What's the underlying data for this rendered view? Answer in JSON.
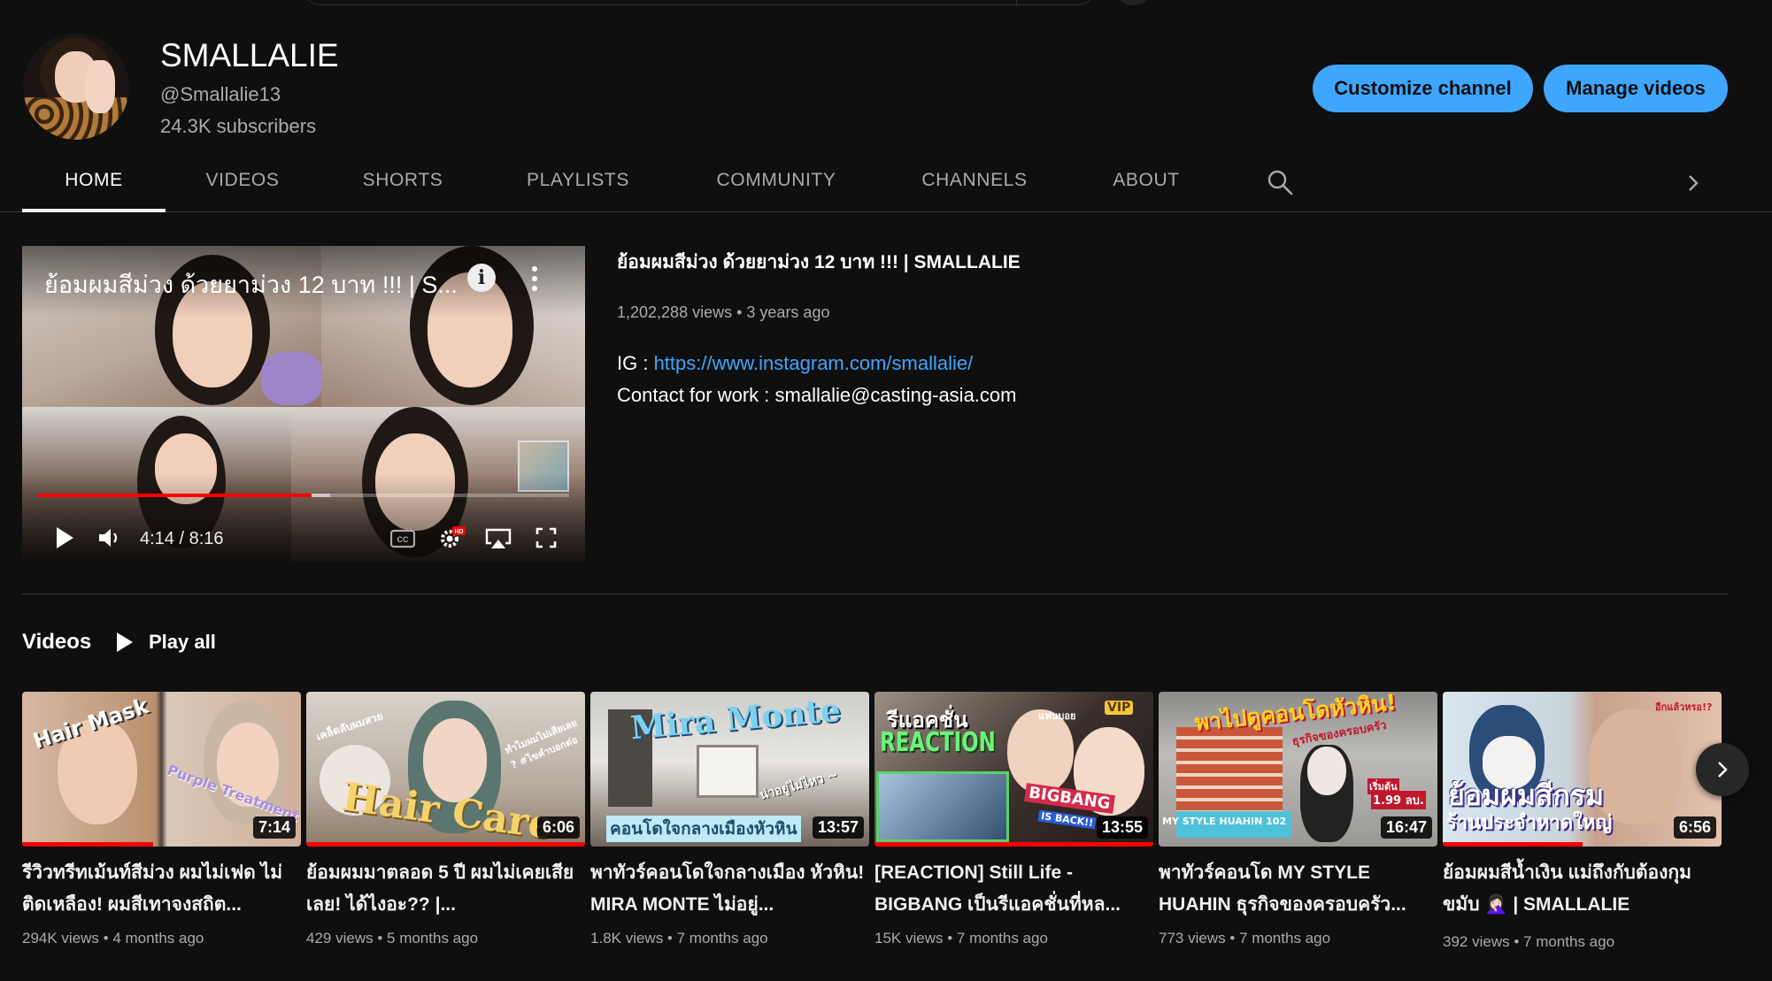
{
  "channel": {
    "name": "SMALLALIE",
    "handle": "@Smallalie13",
    "subscribers": "24.3K subscribers"
  },
  "actions": {
    "customize": "Customize channel",
    "manage": "Manage videos"
  },
  "tabs": [
    {
      "label": "HOME",
      "active": true
    },
    {
      "label": "VIDEOS"
    },
    {
      "label": "SHORTS"
    },
    {
      "label": "PLAYLISTS"
    },
    {
      "label": "COMMUNITY"
    },
    {
      "label": "CHANNELS"
    },
    {
      "label": "ABOUT"
    }
  ],
  "featured": {
    "overlay_title": "ย้อมผมสีม่วง ด้วยยาม่วง 12 บาท !!! | S...",
    "time": "4:14 / 8:16",
    "progress": 0.515,
    "buffered": 0.55,
    "title": "ย้อมผมสีม่วง ด้วยยาม่วง 12 บาท !!! | SMALLALIE",
    "views": "1,202,288 views",
    "age": "3 years ago",
    "ig_label": "IG : ",
    "ig_link": "https://www.instagram.com/smallalie/",
    "contact": "Contact for work : smallalie@casting-asia.com"
  },
  "shelf": {
    "title": "Videos",
    "play_all": "Play all"
  },
  "videos": [
    {
      "title": "รีวิวทรีทเม้นท์สีม่วง ผมไม่เฟด ไม่ติดเหลือง! ผมสีเทาจงสถิต...",
      "duration": "7:14",
      "views": "294K views",
      "age": "4 months ago",
      "watched": 0.47,
      "thumb_text": [
        "Hair Mask",
        "Purple Treatment"
      ]
    },
    {
      "title": "ย้อมผมมาตลอด 5 ปี ผมไม่เคยเสียเลย! ได้ไงอะ?? |...",
      "duration": "6:06",
      "views": "429 views",
      "age": "5 months ago",
      "watched": 1.0,
      "thumb_text": [
        "Hair Care",
        "เคล็ดลับผมสวย",
        "ทำไมผมไม่เสียเลย ? #ไขคำบอกต่อ"
      ]
    },
    {
      "title": "พาทัวร์คอนโดใจกลางเมือง หัวหิน! MIRA MONTE ไม่อยู่...",
      "duration": "13:57",
      "views": "1.8K views",
      "age": "7 months ago",
      "watched": 0,
      "thumb_text": [
        "Mira Monte",
        "คอนโดใจกลางเมืองหัวหิน",
        "น่าอยู่ไม่ไหว ~"
      ]
    },
    {
      "title": "[REACTION] Still Life - BIGBANG เป็นรีแอคชั่นที่หล...",
      "duration": "13:55",
      "views": "15K views",
      "age": "7 months ago",
      "watched": 1.0,
      "thumb_text": [
        "รีแอคชั่น",
        "REACTION",
        "BIGBANG",
        "IS BACK!!",
        "แฟนบอย",
        "VIP"
      ]
    },
    {
      "title": "พาทัวร์คอนโด MY STYLE HUAHIN ธุรกิจของครอบครัว...",
      "duration": "16:47",
      "views": "773 views",
      "age": "7 months ago",
      "watched": 0,
      "thumb_text": [
        "พาไปดูคอนโดหัวหิน!",
        "ธุรกิจของครอบครัว",
        "MY STYLE HUAHIN 102",
        "เริ่มต้น",
        "1.99 ลบ."
      ]
    },
    {
      "title": "ย้อมผมสีน้ำเงิน แม่ถึงกับต้องกุมขมับ 🤦🏻‍♀️ | SMALLALIE",
      "duration": "6:56",
      "views": "392 views",
      "age": "7 months ago",
      "watched": 0.5,
      "thumb_text": [
        "ย้อมผมสีกรม",
        "ร้านประจำหาดใหญ่",
        "อีกแล้วหรอ!?"
      ]
    }
  ],
  "colors": {
    "background": "#0f0f0f",
    "accent_button": "#3ea6ff",
    "link": "#3ea6ff",
    "progress": "#ff0000",
    "muted_text": "#aaaaaa"
  },
  "icons": [
    "search-icon",
    "chevron-right-icon",
    "play-icon",
    "volume-icon",
    "captions-icon",
    "settings-icon",
    "airplay-icon",
    "fullscreen-icon",
    "info-icon",
    "more-vert-icon"
  ]
}
